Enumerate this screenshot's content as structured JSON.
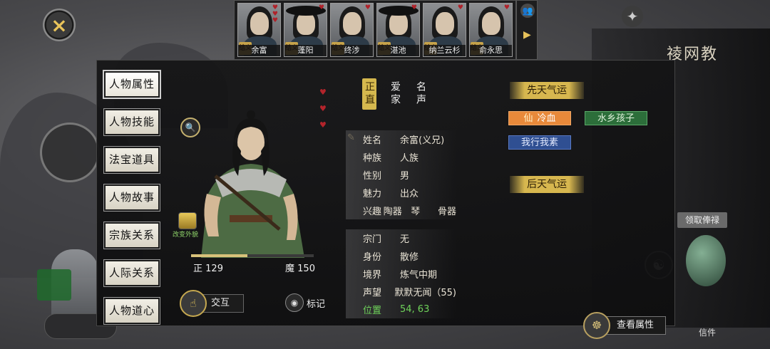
{
  "top_bar": {
    "close_icon": "×",
    "settings_icon": "✦",
    "more_arrow": "▶",
    "people_icon": "👥",
    "companions": [
      {
        "name": "余富",
        "badge": "结义",
        "hearts": 3,
        "hat": false
      },
      {
        "name": "蓬阳",
        "badge": "结义",
        "hearts": 1,
        "hat": true
      },
      {
        "name": "终涉",
        "badge": "结义",
        "hearts": 1,
        "hat": false
      },
      {
        "name": "湛池",
        "badge": "结义",
        "hearts": 1,
        "hat": true
      },
      {
        "name": "纳兰云杉",
        "badge": "结义",
        "hearts": 1,
        "hat": false
      },
      {
        "name": "俞永思",
        "badge": "结义",
        "hearts": 1,
        "hat": false
      }
    ]
  },
  "sidebar": {
    "tabs": [
      {
        "label": "人物属性",
        "active": true
      },
      {
        "label": "人物技能",
        "active": false
      },
      {
        "label": "法宝道具",
        "active": false
      },
      {
        "label": "人物故事",
        "active": false
      },
      {
        "label": "宗族关系",
        "active": false
      },
      {
        "label": "人际关系",
        "active": false
      },
      {
        "label": "人物道心",
        "active": false
      }
    ]
  },
  "character": {
    "change_look_label": "改变外貌",
    "morality": {
      "zheng_label": "正",
      "zheng_value": "129",
      "mo_label": "魔",
      "mo_value": "150",
      "zheng_fraction": 0.46
    },
    "hearts": 3,
    "interact_label": "交互",
    "mark_label": "标记"
  },
  "personality_tabs": [
    {
      "label": "正直",
      "active": true
    },
    {
      "label": "爱家",
      "active": false
    },
    {
      "label": "名声",
      "active": false
    }
  ],
  "info": {
    "group1": [
      {
        "key": "姓名",
        "value": "余富(义兄)"
      },
      {
        "key": "种族",
        "value": "人族"
      },
      {
        "key": "性别",
        "value": "男"
      },
      {
        "key": "魅力",
        "value": "出众"
      },
      {
        "key": "兴趣",
        "value": "陶器   琴      骨器"
      }
    ],
    "group2": [
      {
        "key": "宗门",
        "value": "无"
      },
      {
        "key": "身份",
        "value": "散修"
      },
      {
        "key": "境界",
        "value": "炼气中期"
      },
      {
        "key": "声望",
        "value": "默默无闻（55)"
      }
    ],
    "position": {
      "key": "位置",
      "value": "54, 63"
    }
  },
  "destiny": {
    "innate_title": "先天气运",
    "acquired_title": "后天气运",
    "traits": [
      {
        "prefix": "仙",
        "label": "冷血",
        "color": "#e8893a"
      },
      {
        "prefix": "",
        "label": "水乡孩子",
        "color": "#2c6e3a"
      },
      {
        "prefix": "",
        "label": "我行我素",
        "color": "#2f4f92"
      }
    ]
  },
  "bottom": {
    "view_attributes_label": "查看属性"
  },
  "background": {
    "right_title": "祾网教",
    "claim_label": "领取俸禄",
    "letter_label": "信件"
  }
}
